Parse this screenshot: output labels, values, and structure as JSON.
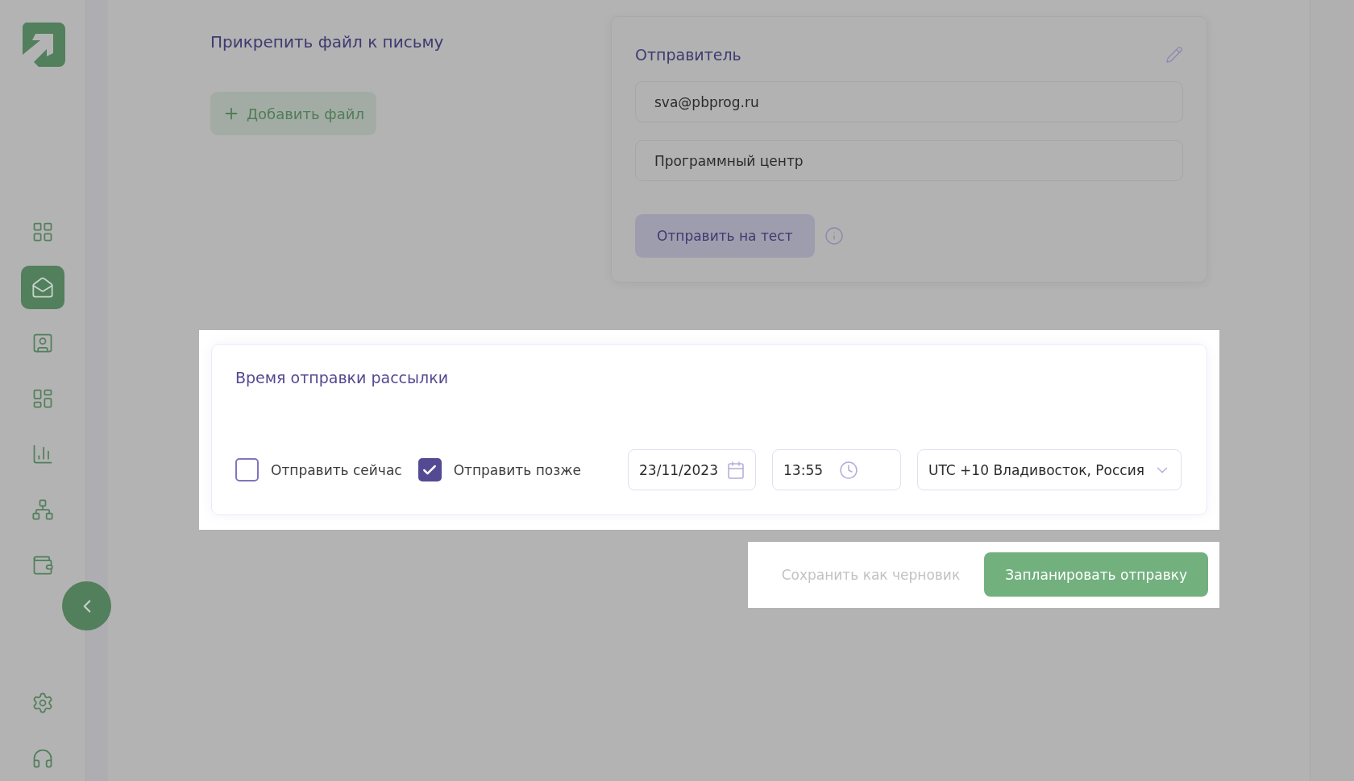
{
  "sidebar": {
    "items": [
      {
        "selected": false
      },
      {
        "selected": true
      },
      {
        "selected": false
      },
      {
        "selected": false
      },
      {
        "selected": false
      },
      {
        "selected": false
      },
      {
        "selected": false
      }
    ],
    "bottom_items": [
      {
        "selected": false
      },
      {
        "selected": false
      }
    ]
  },
  "attachments": {
    "title": "Прикрепить файл к письму",
    "add_button": "Добавить файл"
  },
  "sender": {
    "title": "Отправитель",
    "email": "sva@pbprog.ru",
    "name": "Программный центр",
    "test_button": "Отправить на тест"
  },
  "schedule": {
    "title": "Время отправки рассылки",
    "options": [
      {
        "label": "Отправить сейчас",
        "checked": false
      },
      {
        "label": "Отправить позже",
        "checked": true
      }
    ],
    "date": "23/11/2023",
    "time": "13:55",
    "timezone": "UTC +10 Владивосток, Россия"
  },
  "actions": {
    "draft": "Сохранить как черновик",
    "primary": "Запланировать отправку"
  }
}
